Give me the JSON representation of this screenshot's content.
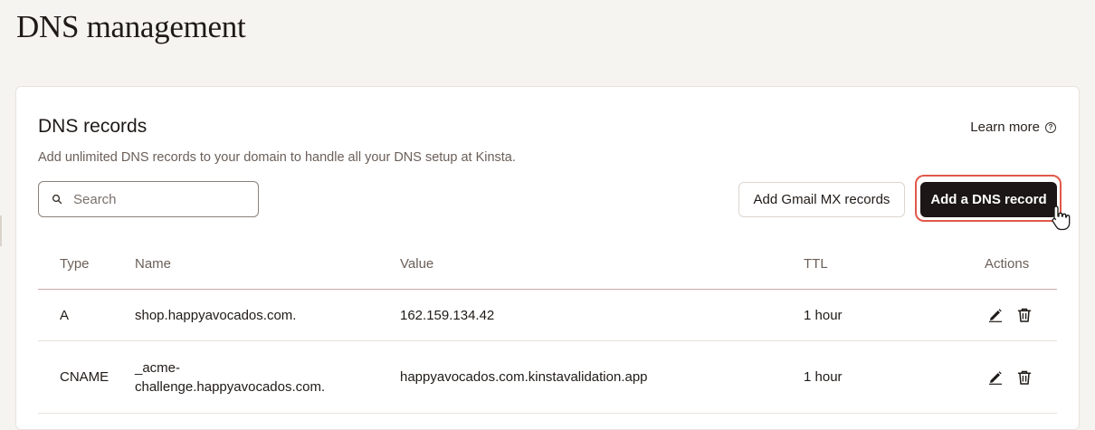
{
  "page": {
    "title": "DNS management"
  },
  "card": {
    "title": "DNS records",
    "learn_more": "Learn more",
    "description": "Add unlimited DNS records to your domain to handle all your DNS setup at Kinsta."
  },
  "search": {
    "placeholder": "Search",
    "value": ""
  },
  "buttons": {
    "gmail_mx": "Add Gmail MX records",
    "add_record": "Add a DNS record"
  },
  "table": {
    "headers": {
      "type": "Type",
      "name": "Name",
      "value": "Value",
      "ttl": "TTL",
      "actions": "Actions"
    },
    "rows": [
      {
        "type": "A",
        "name": "shop.happyavocados.com.",
        "value": "162.159.134.42",
        "ttl": "1 hour"
      },
      {
        "type": "CNAME",
        "name": "_acme-challenge.happyavocados.com.",
        "value": "happyavocados.com.kinstavalidation.app",
        "ttl": "1 hour"
      }
    ]
  },
  "icons": {
    "help": "help-circle-icon",
    "search": "search-icon",
    "edit": "pencil-icon",
    "delete": "trash-icon",
    "cursor": "pointer-cursor-icon"
  },
  "colors": {
    "page_bg": "#f6f4f1",
    "primary_button": "#1c1616",
    "focus_ring": "#e0584a",
    "header_divider": "#c8aca5"
  }
}
